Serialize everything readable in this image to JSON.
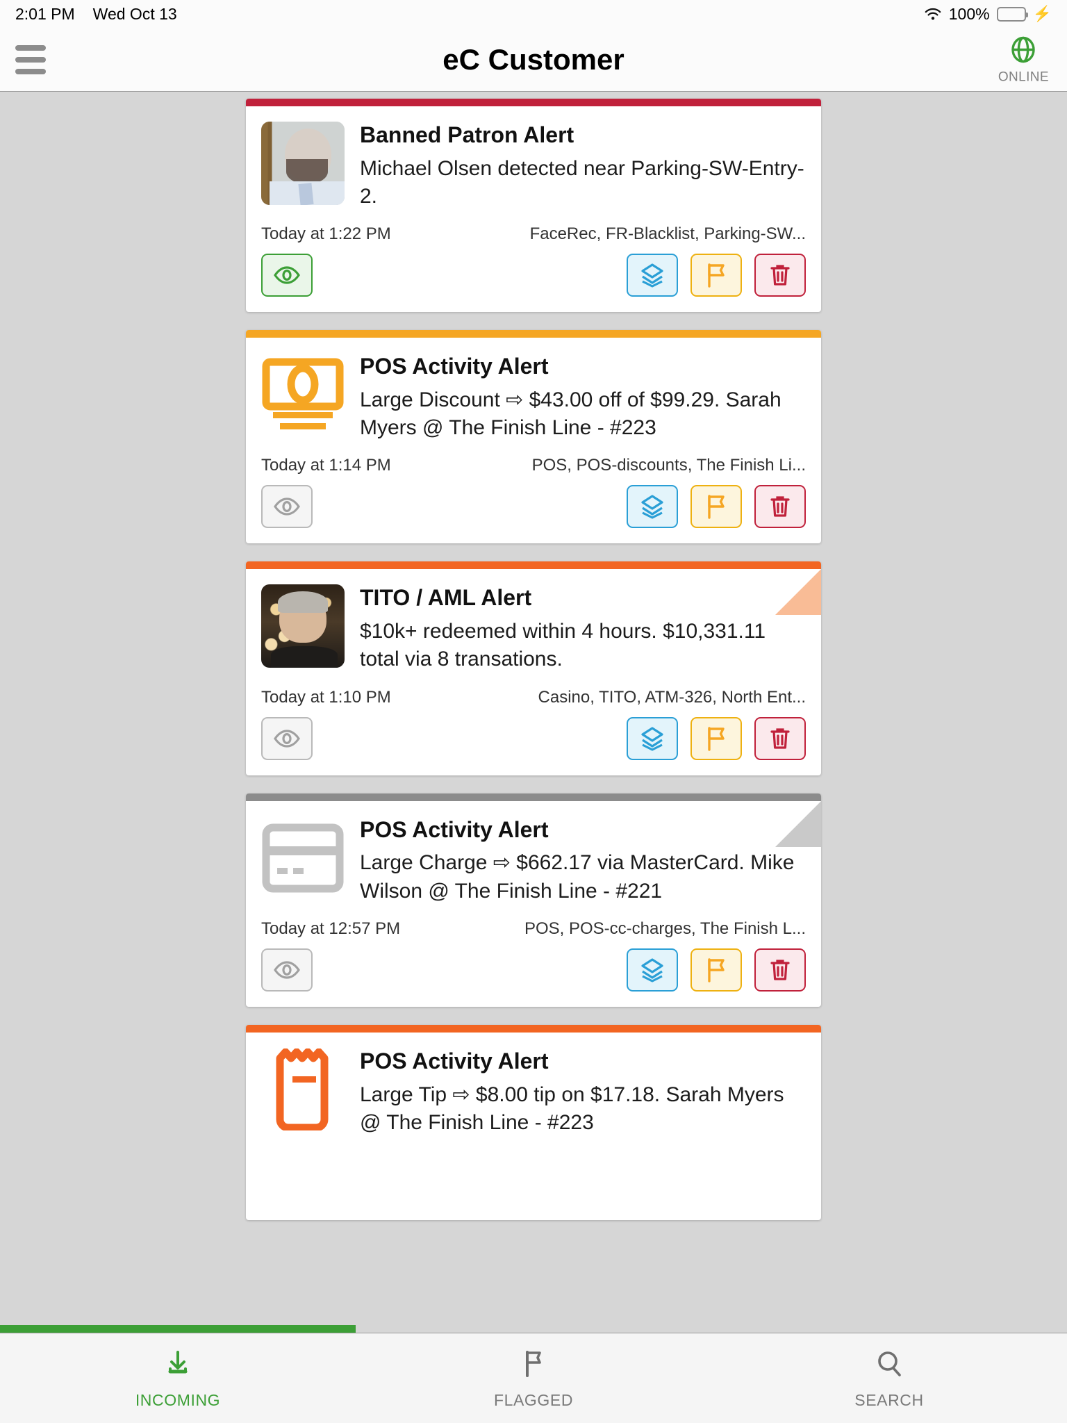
{
  "statusbar": {
    "time": "2:01 PM",
    "date": "Wed Oct 13",
    "battery_percent": "100%",
    "wifi_icon": "wifi-icon",
    "battery_icon": "battery-full-icon",
    "charging_icon": "lightning-bolt-icon"
  },
  "navbar": {
    "title": "eC Customer",
    "menu_icon": "hamburger-menu-icon",
    "status_icon": "globe-icon",
    "status_label": "ONLINE",
    "status_color": "#3c9f36"
  },
  "colors": {
    "severity_red": "#c0213b",
    "severity_amber": "#f5a623",
    "severity_orange": "#f26522",
    "severity_grey": "#8c8c8c",
    "accent_green": "#3c9f36",
    "accent_blue": "#2a9fd6",
    "page_background": "#d6d6d6"
  },
  "action_labels": {
    "view": "eye-icon",
    "stack": "layers-stack-icon",
    "flag": "flag-icon",
    "delete": "trash-icon"
  },
  "cards": [
    {
      "id": "banned-patron-alert",
      "accent": "#c0213b",
      "corner_fold": false,
      "thumb_type": "photo-face-a",
      "title": "Banned Patron Alert",
      "description": "Michael Olsen detected near Parking-SW-Entry-2.",
      "timestamp": "Today at 1:22 PM",
      "tags": "FaceRec, FR-Blacklist, Parking-SW...",
      "viewed": true
    },
    {
      "id": "pos-activity-alert-discount",
      "accent": "#f5a623",
      "corner_fold": false,
      "thumb_type": "money-bill-icon",
      "title": "POS Activity Alert",
      "description": "Large Discount ⇨ $43.00 off of $99.29. Sarah Myers @ The Finish Line - #223",
      "timestamp": "Today at 1:14 PM",
      "tags": "POS, POS-discounts, The Finish Li...",
      "viewed": false
    },
    {
      "id": "tito-aml-alert",
      "accent": "#f26522",
      "corner_fold": true,
      "corner_color": "#f9bc96",
      "thumb_type": "photo-face-b",
      "title": "TITO / AML Alert",
      "description": "$10k+ redeemed within 4 hours. $10,331.11 total via 8 transations.",
      "timestamp": "Today at 1:10 PM",
      "tags": "Casino, TITO, ATM-326, North Ent...",
      "viewed": false
    },
    {
      "id": "pos-activity-alert-charge",
      "accent": "#8c8c8c",
      "corner_fold": true,
      "corner_color": "#c9c9c9",
      "thumb_type": "credit-card-icon",
      "title": "POS Activity Alert",
      "description": "Large Charge ⇨ $662.17 via MasterCard.  Mike Wilson @ The Finish Line - #221",
      "timestamp": "Today at 12:57 PM",
      "tags": "POS, POS-cc-charges, The Finish L...",
      "viewed": false
    },
    {
      "id": "pos-activity-alert-tip",
      "accent": "#f26522",
      "corner_fold": false,
      "thumb_type": "receipt-icon",
      "title": "POS Activity Alert",
      "description": "Large Tip ⇨ $8.00 tip on $17.18. Sarah Myers @ The Finish Line - #223",
      "timestamp": "",
      "tags": "",
      "viewed": false
    }
  ],
  "tabs": [
    {
      "id": "incoming",
      "label": "INCOMING",
      "icon": "download-arrow-icon",
      "active": true
    },
    {
      "id": "flagged",
      "label": "FLAGGED",
      "icon": "flag-icon",
      "active": false
    },
    {
      "id": "search",
      "label": "SEARCH",
      "icon": "magnifier-icon",
      "active": false
    }
  ]
}
